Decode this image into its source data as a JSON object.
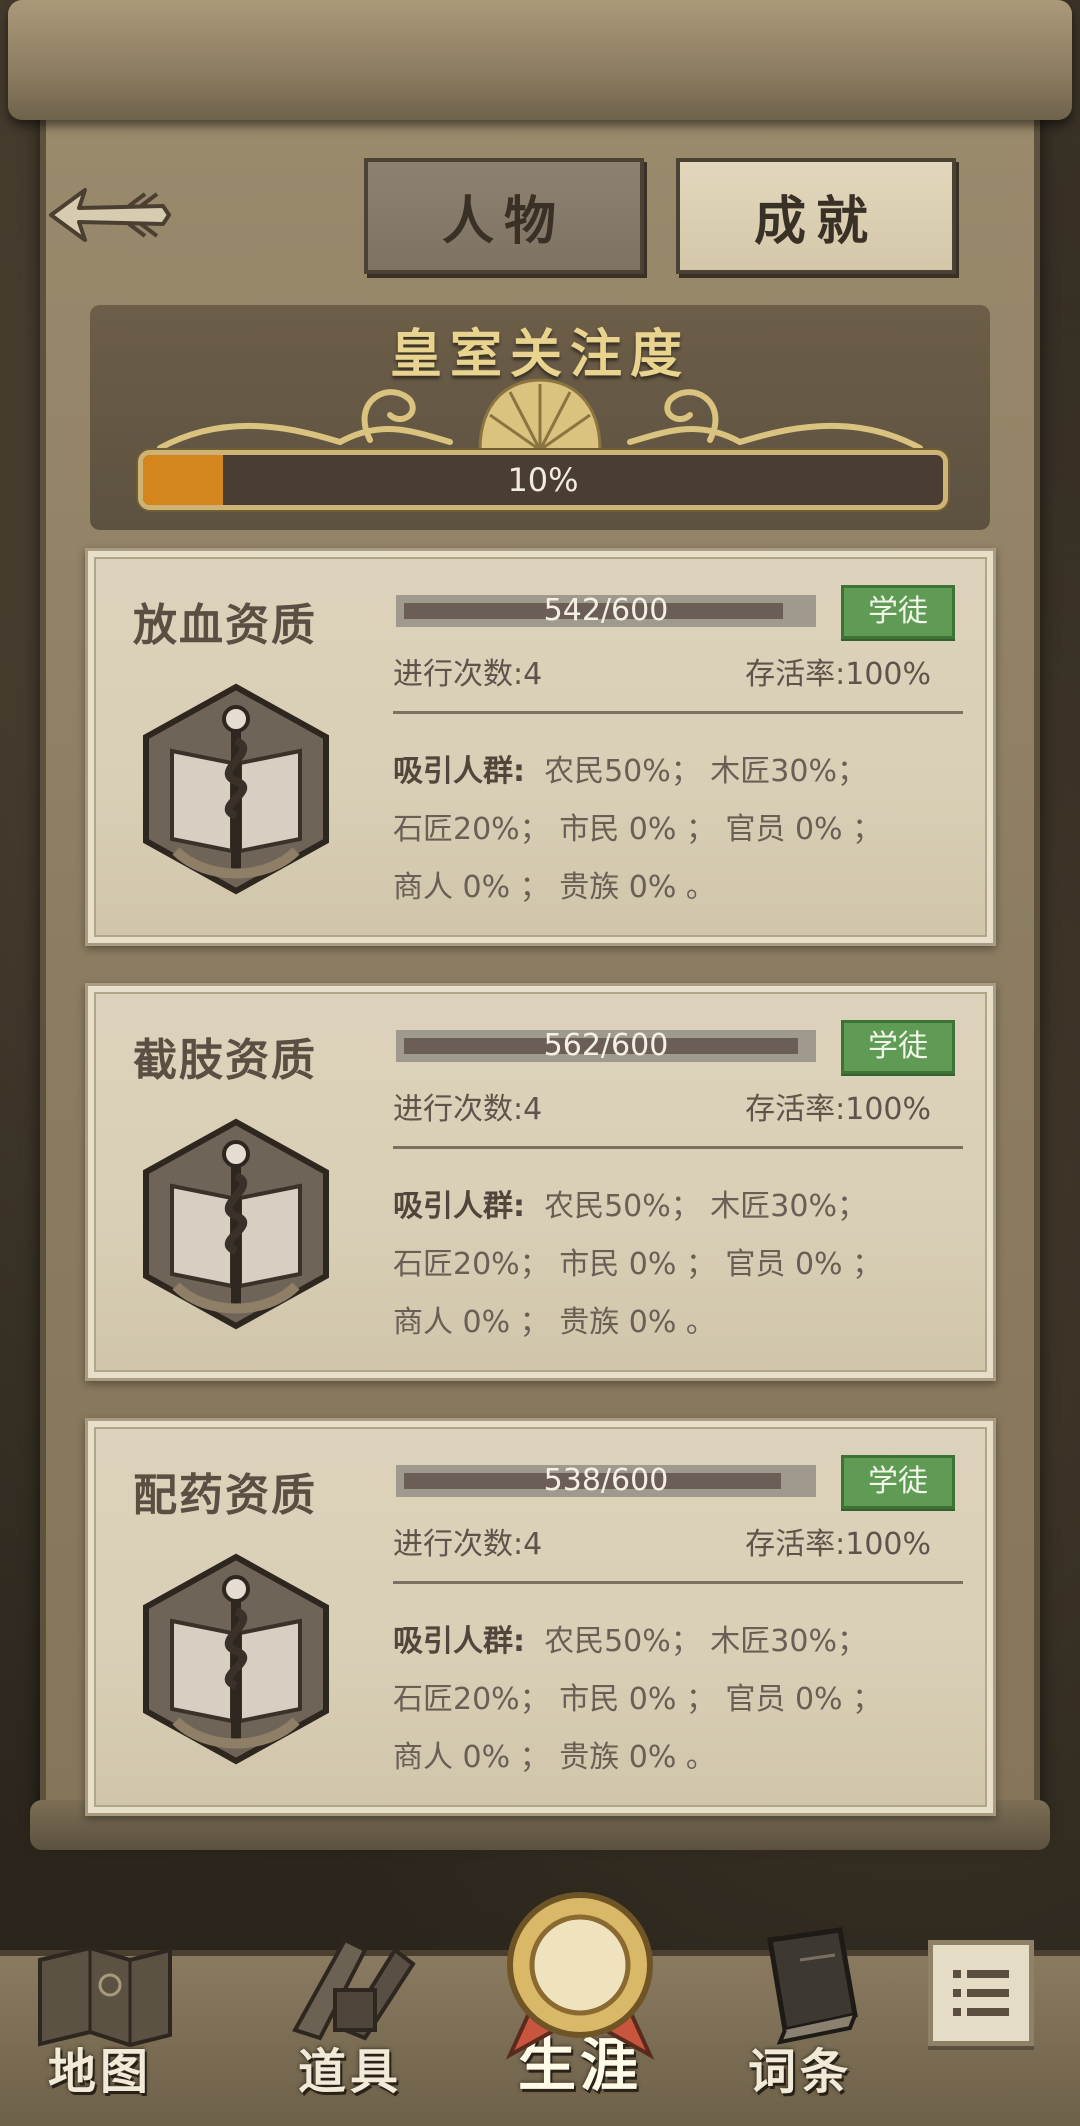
{
  "header": {
    "tabs": [
      {
        "label": "人物",
        "active": true
      },
      {
        "label": "成就",
        "active": false
      }
    ]
  },
  "royal_attention": {
    "title": "皇室关注度",
    "percent_label": "10%",
    "progress": 0.1
  },
  "cards": [
    {
      "title": "放血资质",
      "progress_label": "542/600",
      "progress": 0.903,
      "badge": "学徒",
      "attempts": "进行次数:4",
      "survival": "存活率:100%",
      "attract_label": "吸引人群:",
      "line1": "农民50%； 木匠30%；",
      "line2": "石匠20%； 市民  0% ； 官员  0% ；",
      "line3": "商人  0% ； 贵族  0% 。"
    },
    {
      "title": "截肢资质",
      "progress_label": "562/600",
      "progress": 0.937,
      "badge": "学徒",
      "attempts": "进行次数:4",
      "survival": "存活率:100%",
      "attract_label": "吸引人群:",
      "line1": "农民50%； 木匠30%；",
      "line2": "石匠20%； 市民  0% ； 官员  0% ；",
      "line3": "商人  0% ； 贵族  0% 。"
    },
    {
      "title": "配药资质",
      "progress_label": "538/600",
      "progress": 0.897,
      "badge": "学徒",
      "attempts": "进行次数:4",
      "survival": "存活率:100%",
      "attract_label": "吸引人群:",
      "line1": "农民50%； 木匠30%；",
      "line2": "石匠20%； 市民  0% ； 官员  0% ；",
      "line3": "商人  0% ； 贵族  0% 。"
    }
  ],
  "nav": {
    "items": [
      {
        "label": "地图",
        "icon": "map-icon"
      },
      {
        "label": "道具",
        "icon": "items-icon"
      },
      {
        "label": "生涯",
        "icon": "medal-icon",
        "active": true
      },
      {
        "label": "词条",
        "icon": "book-icon"
      }
    ],
    "menu_icon": "list-icon"
  },
  "colors": {
    "accent_gold": "#e8d48f",
    "progress_orange": "#d4861e",
    "badge_green": "#5f9b54"
  }
}
